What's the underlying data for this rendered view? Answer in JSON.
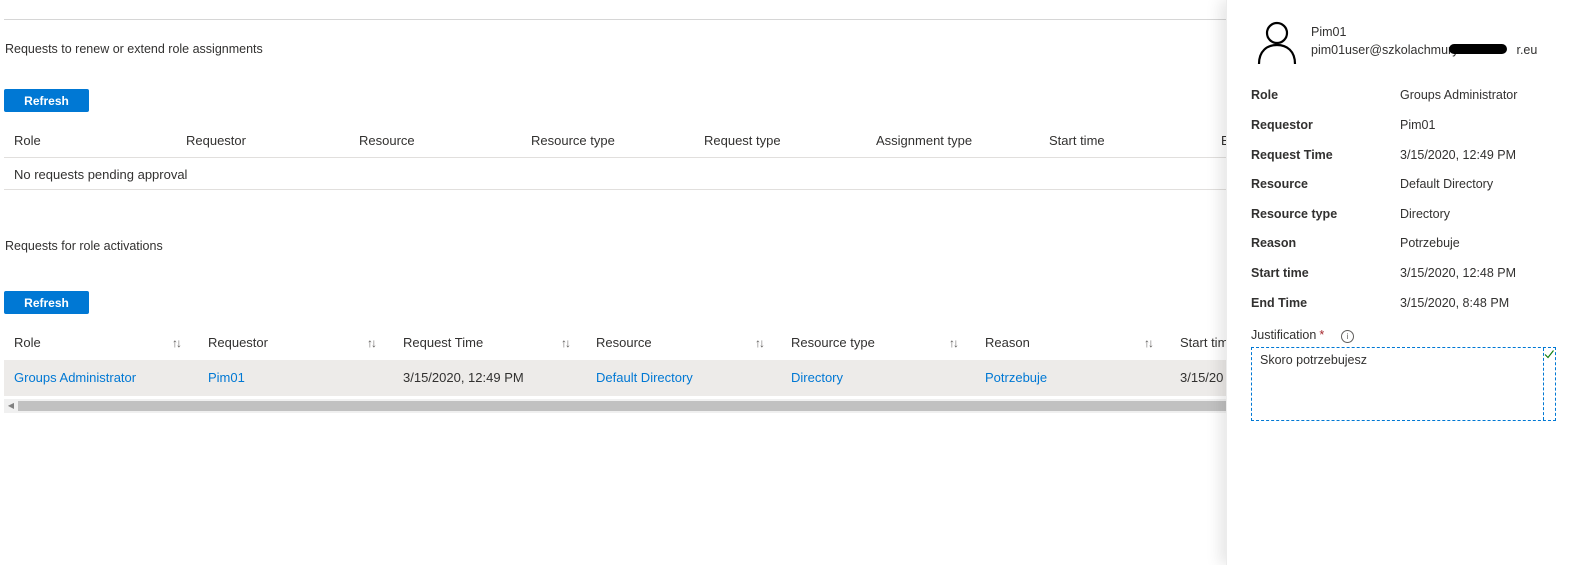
{
  "renew_section": {
    "title": "Requests to renew or extend role assignments",
    "refresh_label": "Refresh",
    "columns": [
      "Role",
      "Requestor",
      "Resource",
      "Resource type",
      "Request type",
      "Assignment type",
      "Start time",
      "E"
    ],
    "empty_text": "No requests pending approval"
  },
  "activation_section": {
    "title": "Requests for role activations",
    "refresh_label": "Refresh",
    "columns": [
      "Role",
      "Requestor",
      "Request Time",
      "Resource",
      "Resource type",
      "Reason",
      "Start tim"
    ],
    "sort_glyph": "↑↓",
    "rows": [
      {
        "role": "Groups Administrator",
        "requestor": "Pim01",
        "request_time": "3/15/2020, 12:49 PM",
        "resource": "Default Directory",
        "resource_type": "Directory",
        "reason": "Potrzebuje",
        "start_time": "3/15/20"
      }
    ],
    "scroll_left_glyph": "◀"
  },
  "details_panel": {
    "user_name": "Pim01",
    "user_email": "pim01user@szkolachmury",
    "user_email_suffix": "r.eu",
    "fields": [
      {
        "label": "Role",
        "value": "Groups Administrator"
      },
      {
        "label": "Requestor",
        "value": "Pim01"
      },
      {
        "label": "Request Time",
        "value": "3/15/2020, 12:49 PM"
      },
      {
        "label": "Resource",
        "value": "Default Directory"
      },
      {
        "label": "Resource type",
        "value": "Directory"
      },
      {
        "label": "Reason",
        "value": "Potrzebuje"
      },
      {
        "label": "Start time",
        "value": "3/15/2020, 12:48 PM"
      },
      {
        "label": "End Time",
        "value": "3/15/2020, 8:48 PM"
      }
    ],
    "justification_label": "Justification",
    "required_mark": "*",
    "info_glyph": "i",
    "justification_value": "Skoro potrzebujesz"
  },
  "colors": {
    "accent": "#0078d4",
    "selected_row": "#edebe9",
    "required": "#a4262c",
    "check": "#107c10"
  }
}
